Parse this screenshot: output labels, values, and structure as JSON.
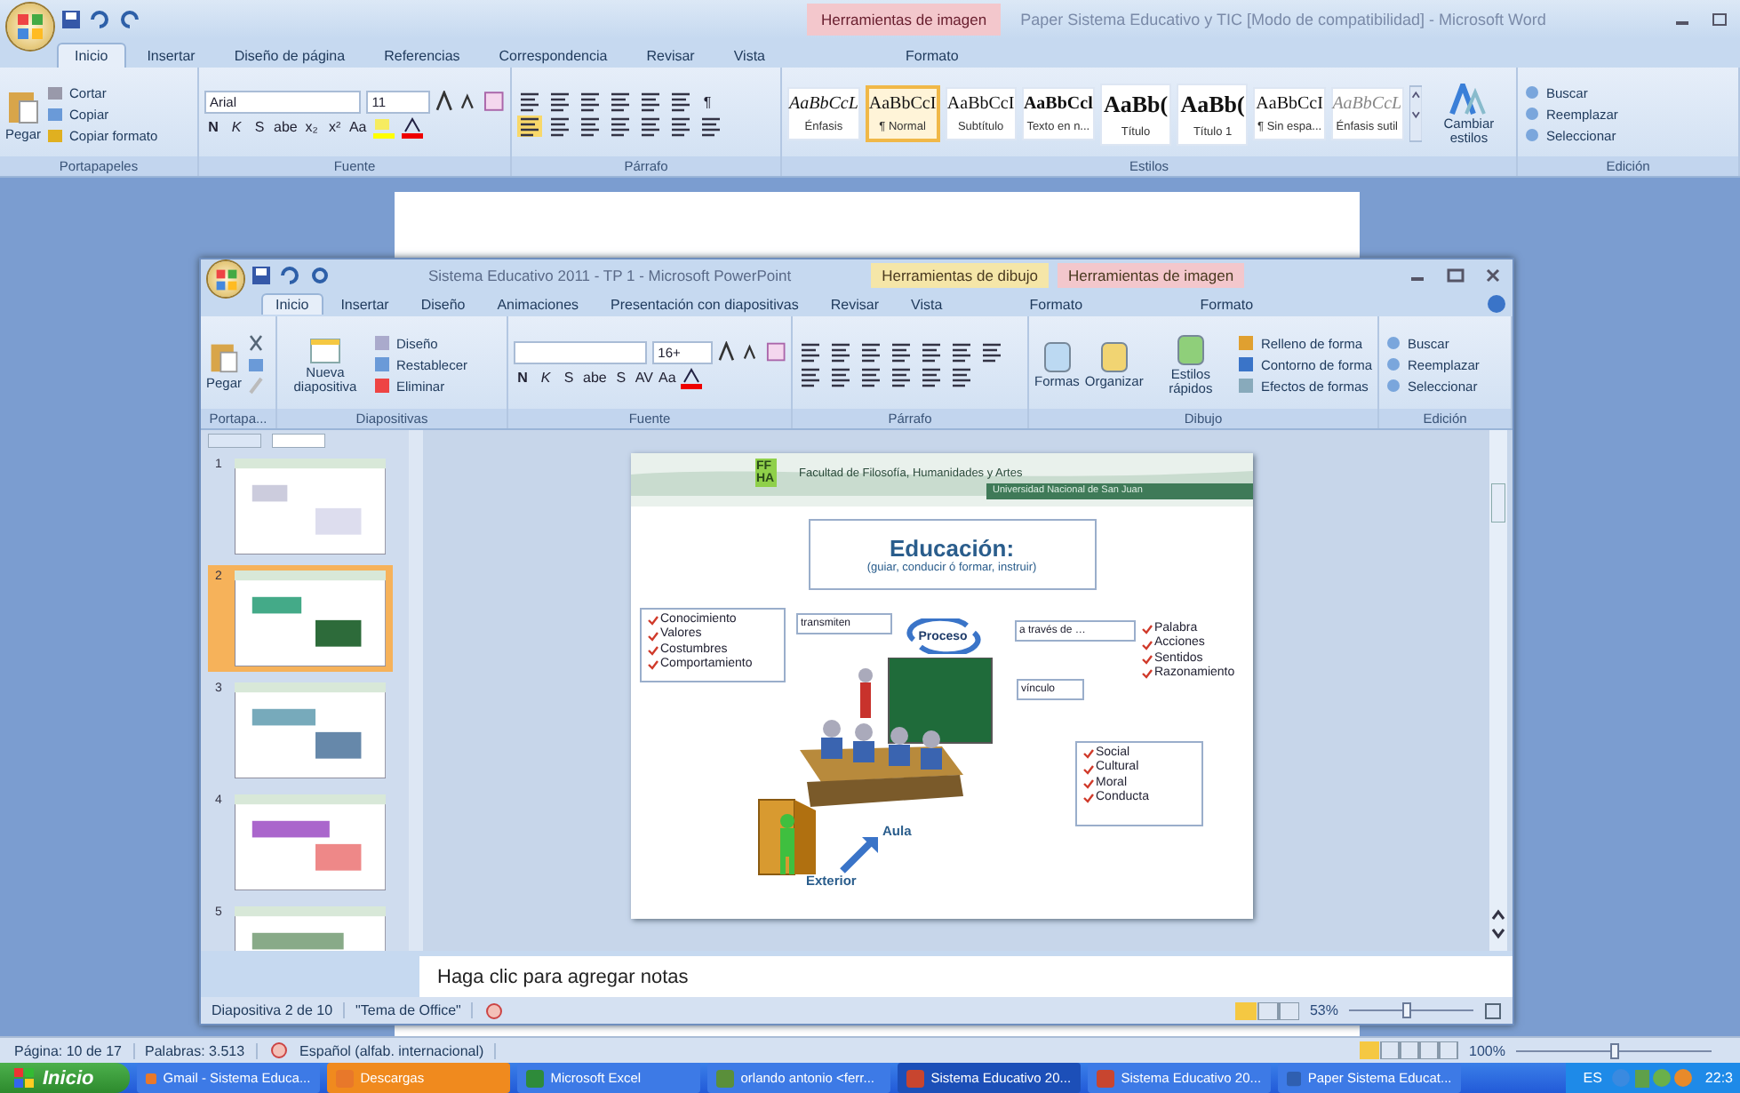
{
  "word": {
    "title": "Paper Sistema Educativo y TIC [Modo de compatibilidad] - Microsoft Word",
    "context_groups": [
      {
        "label": "Herramientas de imagen",
        "tab": "Formato",
        "color": "#f3c7cc"
      }
    ],
    "tabs": [
      {
        "label": "Inicio",
        "selected": true
      },
      {
        "label": "Insertar",
        "selected": false
      },
      {
        "label": "Diseño de página",
        "selected": false
      },
      {
        "label": "Referencias",
        "selected": false
      },
      {
        "label": "Correspondencia",
        "selected": false
      },
      {
        "label": "Revisar",
        "selected": false
      },
      {
        "label": "Vista",
        "selected": false
      }
    ],
    "clipboard": {
      "group": "Portapapeles",
      "paste": "Pegar",
      "items": [
        "Cortar",
        "Copiar",
        "Copiar formato"
      ]
    },
    "font": {
      "group": "Fuente",
      "family": "Arial",
      "size": "11",
      "buttons": [
        "N",
        "K",
        "S",
        "abe",
        "x₂",
        "x²",
        "Aa"
      ]
    },
    "paragraph": {
      "group": "Párrafo",
      "marks": "¶"
    },
    "styles": {
      "group": "Estilos",
      "change": "Cambiar estilos",
      "items": [
        {
          "preview": "AaBbCcL",
          "label": "Énfasis",
          "kind": "italic",
          "selected": false
        },
        {
          "preview": "AaBbCcI",
          "label": "¶ Normal",
          "kind": "plain",
          "selected": true
        },
        {
          "preview": "AaBbCcI",
          "label": "Subtítulo",
          "kind": "plain",
          "selected": false
        },
        {
          "preview": "AaBbCcl",
          "label": "Texto en n...",
          "kind": "bold",
          "selected": false
        },
        {
          "preview": "AaBb(",
          "label": "Título",
          "kind": "heading",
          "selected": false
        },
        {
          "preview": "AaBb(",
          "label": "Título 1",
          "kind": "heading",
          "selected": false
        },
        {
          "preview": "AaBbCcI",
          "label": "¶ Sin espa...",
          "kind": "plain",
          "selected": false
        },
        {
          "preview": "AaBbCcL",
          "label": "Énfasis sutil",
          "kind": "subtle",
          "selected": false
        }
      ]
    },
    "editing": {
      "group": "Edición",
      "items": [
        "Buscar",
        "Reemplazar",
        "Seleccionar"
      ]
    },
    "status": {
      "page": "Página: 10 de 17",
      "words": "Palabras: 3.513",
      "language": "Español (alfab. internacional)",
      "zoom": "100%",
      "zoom_slider": {
        "level": 0.5
      }
    }
  },
  "powerpoint": {
    "title": "Sistema Educativo 2011 - TP 1 - Microsoft PowerPoint",
    "context_groups": [
      {
        "label": "Herramientas de dibujo",
        "tab": "Formato",
        "color": "#f5e6a8"
      },
      {
        "label": "Herramientas de imagen",
        "tab": "Formato",
        "color": "#f3c7cc"
      }
    ],
    "tabs": [
      {
        "label": "Inicio",
        "selected": true
      },
      {
        "label": "Insertar",
        "selected": false
      },
      {
        "label": "Diseño",
        "selected": false
      },
      {
        "label": "Animaciones",
        "selected": false
      },
      {
        "label": "Presentación con diapositivas",
        "selected": false
      },
      {
        "label": "Revisar",
        "selected": false
      },
      {
        "label": "Vista",
        "selected": false
      }
    ],
    "clipboard": {
      "group": "Portapa...",
      "paste": "Pegar"
    },
    "slides_group": {
      "group": "Diapositivas",
      "new": "Nueva diapositiva",
      "items": [
        "Diseño",
        "Restablecer",
        "Eliminar"
      ]
    },
    "font": {
      "group": "Fuente",
      "size": "16+",
      "buttons": [
        "N",
        "K",
        "S",
        "abe",
        "S",
        "AV",
        "Aa"
      ]
    },
    "paragraph": {
      "group": "Párrafo"
    },
    "drawing": {
      "group": "Dibujo",
      "big": [
        "Formas",
        "Organizar",
        "Estilos rápidos"
      ],
      "items": [
        "Relleno de forma",
        "Contorno de forma",
        "Efectos de formas"
      ]
    },
    "editing": {
      "group": "Edición",
      "items": [
        "Buscar",
        "Reemplazar",
        "Seleccionar"
      ]
    },
    "thumbnails": [
      {
        "number": "1",
        "selected": false
      },
      {
        "number": "2",
        "selected": true
      },
      {
        "number": "3",
        "selected": false
      },
      {
        "number": "4",
        "selected": false
      },
      {
        "number": "5",
        "selected": false
      }
    ],
    "slide": {
      "header": "Facultad de Filosofía, Humanidades y Artes",
      "subheader": "Universidad Nacional de San Juan",
      "logo": [
        "FF",
        "HA"
      ],
      "title": "Educación:",
      "subtitle": "(guiar, conducir ó formar, instruir)",
      "lists": [
        {
          "boxed": true,
          "items": [
            "Conocimiento",
            "Valores",
            "Costumbres",
            "Comportamiento"
          ]
        },
        {
          "boxed": false,
          "items": [
            "Palabra",
            "Acciones",
            "Sentidos",
            "Razonamiento"
          ]
        },
        {
          "boxed": true,
          "items": [
            "Social",
            "Cultural",
            "Moral",
            "Conducta"
          ]
        }
      ],
      "labels": [
        {
          "text": "transmiten",
          "kind": "box"
        },
        {
          "text": "Proceso",
          "kind": "cycle"
        },
        {
          "text": "a través de …",
          "kind": "box"
        },
        {
          "text": "vínculo",
          "kind": "box"
        },
        {
          "text": "Aula",
          "kind": "arrow"
        },
        {
          "text": "Exterior",
          "kind": "arrow"
        }
      ]
    },
    "notes_placeholder": "Haga clic para agregar notas",
    "status": {
      "slide": "Diapositiva 2 de 10",
      "theme": "\"Tema de Office\"",
      "zoom": "53%",
      "zoom_slider": {
        "level": 0.45
      }
    }
  },
  "taskbar": {
    "start": "Inicio",
    "items": [
      {
        "label": "Gmail - Sistema Educa...",
        "selected": false,
        "flashing": false
      },
      {
        "label": "Descargas",
        "selected": false,
        "flashing": true
      },
      {
        "label": "Microsoft Excel",
        "selected": false,
        "flashing": false
      },
      {
        "label": "orlando antonio <ferr...",
        "selected": false,
        "flashing": false
      },
      {
        "label": "Sistema Educativo 20...",
        "selected": true,
        "flashing": false
      },
      {
        "label": "Sistema Educativo 20...",
        "selected": false,
        "flashing": false
      },
      {
        "label": "Paper Sistema Educat...",
        "selected": false,
        "flashing": false
      }
    ],
    "language": "ES",
    "clock": "22:3"
  }
}
